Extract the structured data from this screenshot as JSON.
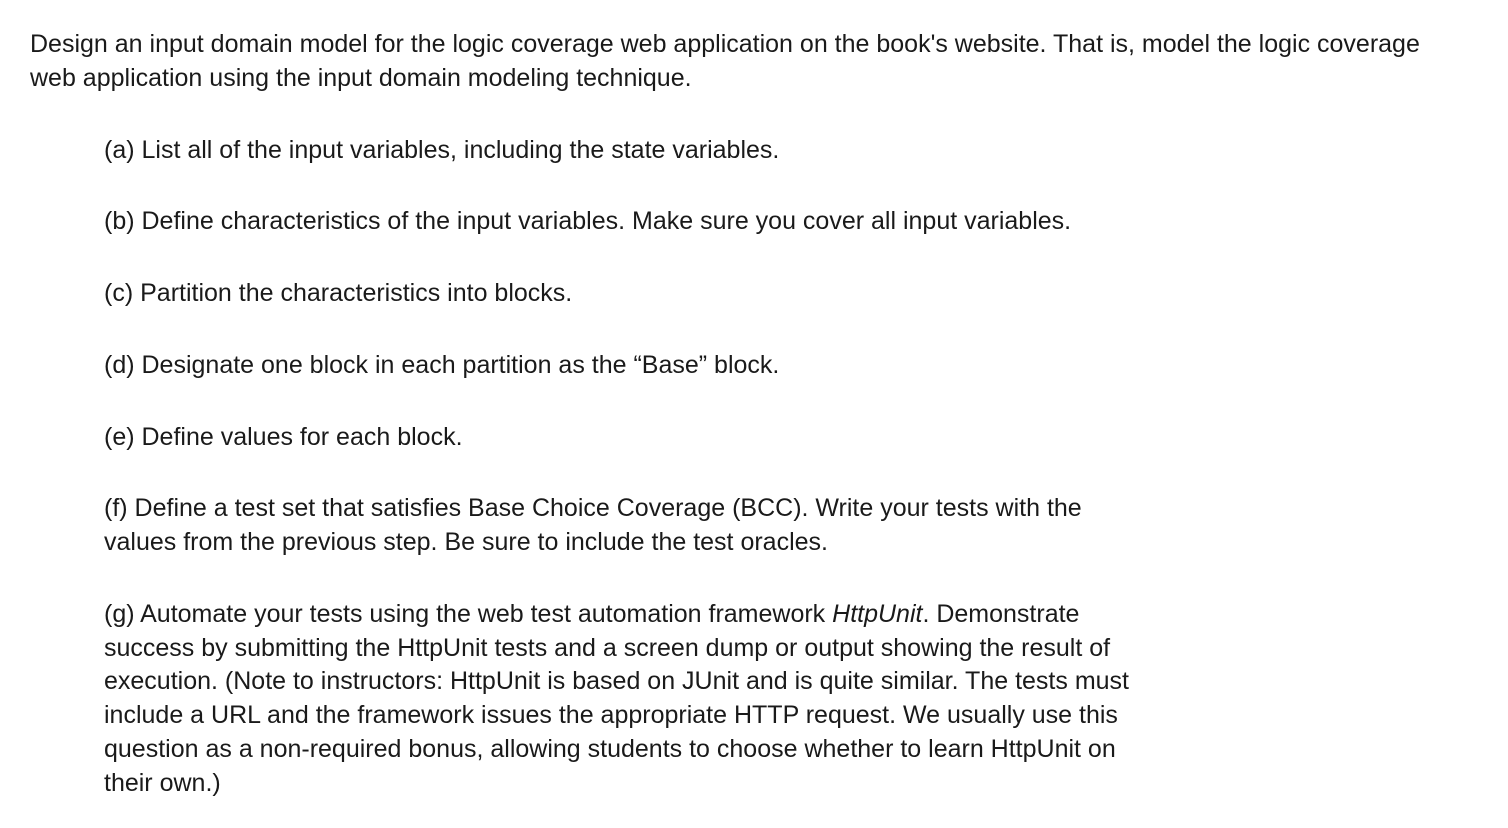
{
  "intro": "Design an input domain model for the logic coverage web application on the book's website. That is, model the logic coverage web application using the input domain modeling technique.",
  "items": {
    "a": {
      "label": "(a)",
      "text": "List all of the input variables, including the state variables."
    },
    "b": {
      "label": "(b)",
      "text": "Define characteristics of the input variables. Make sure you cover all input variables."
    },
    "c": {
      "label": "(c)",
      "text": "Partition the characteristics into blocks."
    },
    "d": {
      "label": "(d)",
      "text": "Designate one block in each partition as the “Base” block."
    },
    "e": {
      "label": "(e)",
      "text": "Define values for each block."
    },
    "f": {
      "label": "(f)",
      "text": "Define a test set that satisfies Base Choice Coverage (BCC). Write your tests with the values from the previous step. Be sure to include the test oracles."
    },
    "g": {
      "label": "(g)",
      "text_before": "Automate your tests using the web test automation framework ",
      "emphasis": "HttpUnit",
      "text_after": ". Demonstrate success by submitting the HttpUnit tests and a screen dump or output showing the result of execution. (Note to instructors: HttpUnit is based on JUnit and is quite similar. The tests must include a URL and the framework issues the appropriate HTTP request. We usually use this question as a non-required bonus, allowing students to choose whether to learn HttpUnit on their own.)"
    }
  }
}
